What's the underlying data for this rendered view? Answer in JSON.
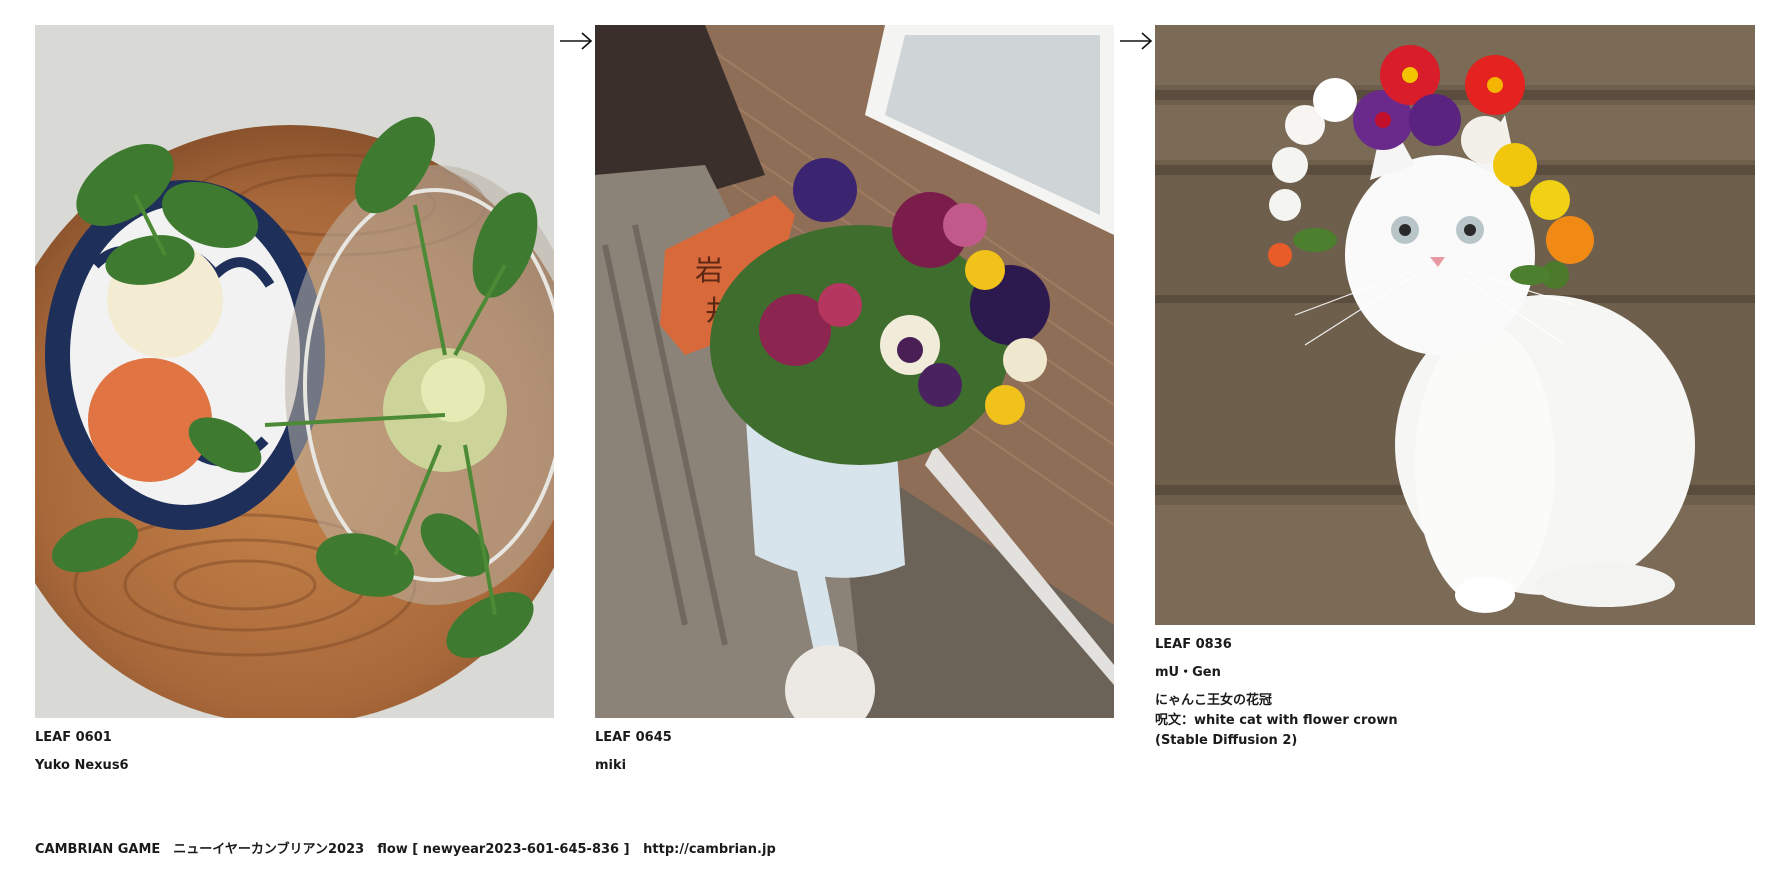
{
  "leaves": [
    {
      "id": "LEAF 0601",
      "author": "Yuko Nexus6",
      "image": "vegetables-on-wooden-plate"
    },
    {
      "id": "LEAF 0645",
      "author": "miki",
      "image": "pansies-in-watering-can"
    },
    {
      "id": "LEAF 0836",
      "author": "mU・Gen",
      "image": "white-cat-with-flower-crown",
      "description": [
        "にゃんこ王女の花冠",
        "呪文：white cat with flower crown",
        "(Stable Diffusion 2)"
      ]
    }
  ],
  "arrows": [
    "arrow-right-icon",
    "arrow-right-icon"
  ],
  "footer": {
    "title": "CAMBRIAN GAME　ニューイヤーカンブリアン2023　flow [ newyear2023-601-645-836 ]",
    "url": "http://cambrian.jp"
  },
  "colors": {
    "background": "#ffffff",
    "text": "#1a1a1a"
  }
}
